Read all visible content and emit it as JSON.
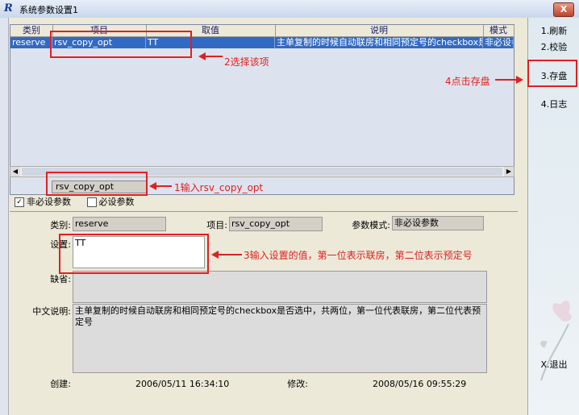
{
  "window": {
    "title": "系统参数设置1",
    "close_label": "X"
  },
  "grid": {
    "columns": [
      "类别",
      "项目",
      "取值",
      "说明",
      "模式"
    ],
    "rows": [
      {
        "category": "reserve",
        "item": "rsv_copy_opt",
        "value": "TT",
        "desc": "主单复制的时候自动联房和相同预定号的checkbox是否选中，共两位",
        "mode": "非必设参数"
      }
    ]
  },
  "filter": {
    "value": "rsv_copy_opt"
  },
  "checks": {
    "optional": "非必设参数",
    "required": "必设参数"
  },
  "detail": {
    "category_label": "类别:",
    "category_value": "reserve",
    "item_label": "项目:",
    "item_value": "rsv_copy_opt",
    "mode_label": "参数模式:",
    "mode_value": "非必设参数",
    "setting_label": "设置:",
    "setting_value": "TT",
    "default_label": "缺省:",
    "default_value": "",
    "desc_label": "中文说明:",
    "desc_value": "主单复制的时候自动联房和相同预定号的checkbox是否选中，共两位，第一位代表联房，第二位代表预定号",
    "created_label": "创建:",
    "created_value": "2006/05/11 16:34:10",
    "modified_label": "修改:",
    "modified_value": "2008/05/16 09:55:29"
  },
  "sidebar": {
    "refresh": "1.刷新",
    "verify": "2.校验",
    "save": "3.存盘",
    "log": "4.日志",
    "exit": "X.退出"
  },
  "annotations": {
    "a1": "1输入rsv_copy_opt",
    "a2": "2选择该项",
    "a3": "3输入设置的值，第一位表示联房，第二位表示预定号",
    "a4": "4点击存盘"
  },
  "colors": {
    "annotation": "#e02020",
    "selection": "#316ac5"
  }
}
